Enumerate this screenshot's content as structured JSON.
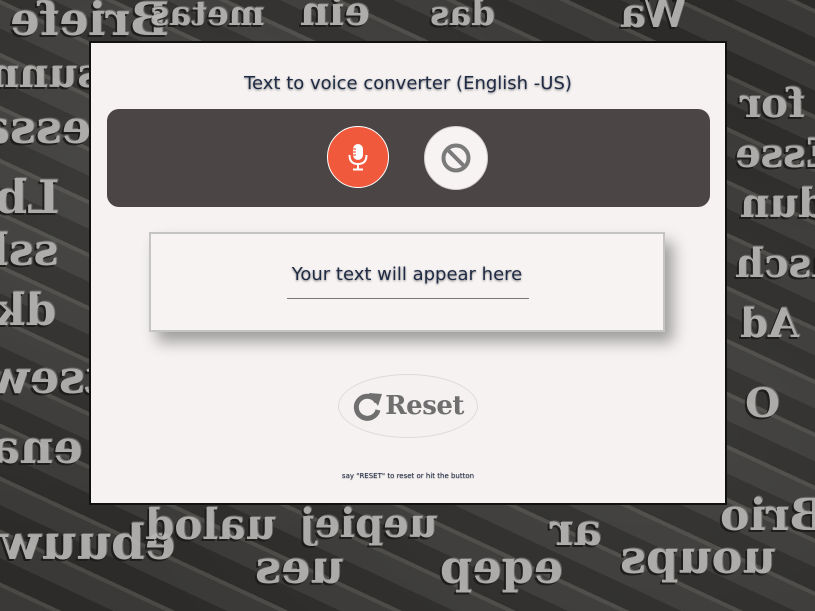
{
  "app": {
    "title": "Text to voice converter (English -US)"
  },
  "controls": {
    "mic_icon": "microphone-icon",
    "stop_icon": "block-icon",
    "mic_color": "#f1593d"
  },
  "output": {
    "placeholder_text": "Your text will appear here"
  },
  "reset": {
    "label": "Reset",
    "icon": "refresh-icon"
  },
  "hint": {
    "text": "say \"RESET\" to reset or hit the button"
  },
  "background": {
    "description_icon": "metal-type-blocks"
  }
}
